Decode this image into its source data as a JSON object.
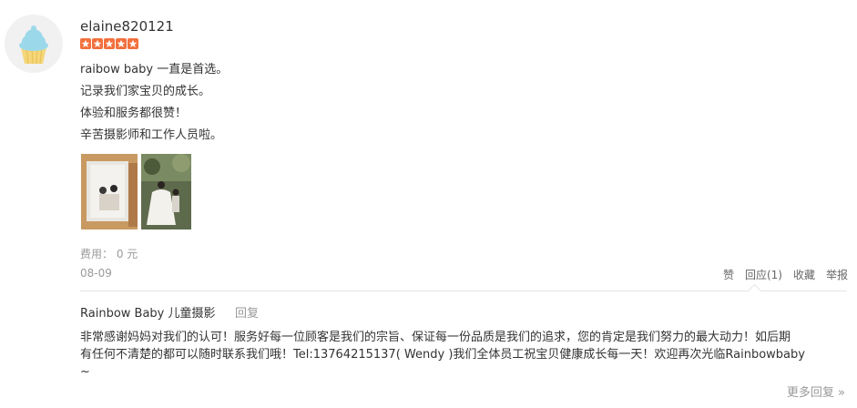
{
  "review": {
    "username": "elaine820121",
    "rating": 5,
    "lines": [
      "raibow baby 一直是首选。",
      "记录我们家宝贝的成长。",
      "体验和服务都很赞！",
      "辛苦摄影师和工作人员啦。"
    ],
    "cost": "费用： 0 元",
    "date": "08-09"
  },
  "actions": {
    "like": "赞",
    "reply_count": "回应(1)",
    "favorite": "收藏",
    "report": "举报"
  },
  "merchant_reply": {
    "name": "Rainbow Baby 儿童摄影",
    "reply_label": "回复",
    "lines": [
      "非常感谢妈妈对我们的认可！服务好每一位顾客是我们的宗旨、保证每一份品质是我们的追求，您的肯定是我们努力的最大动力！如后期",
      "有任何不清楚的都可以随时联系我们哦！Tel:13764215137( Wendy )我们全体员工祝宝贝健康成长每一天！欢迎再次光临Rainbowbaby",
      "~"
    ],
    "more": "更多回复 »"
  },
  "colors": {
    "star": "#f2703d",
    "muted": "#999999",
    "text": "#333333",
    "divider": "#e5e5e5"
  }
}
